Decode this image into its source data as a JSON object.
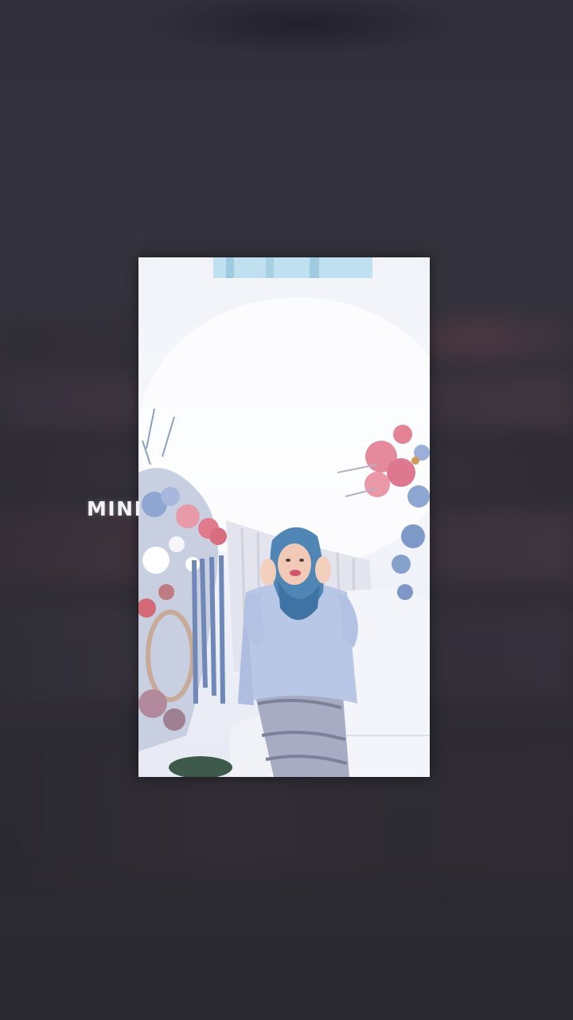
{
  "overlay": {
    "text": "MIND"
  },
  "colors": {
    "background": "#2f2d36",
    "hijab": "#4f86b5",
    "dress": "#b9c7e6",
    "flowers_pink": "#e07a8c",
    "flowers_blue": "#7e99c8"
  },
  "icons": {
    "photo": "photo-of-woman-in-floral-decor"
  }
}
